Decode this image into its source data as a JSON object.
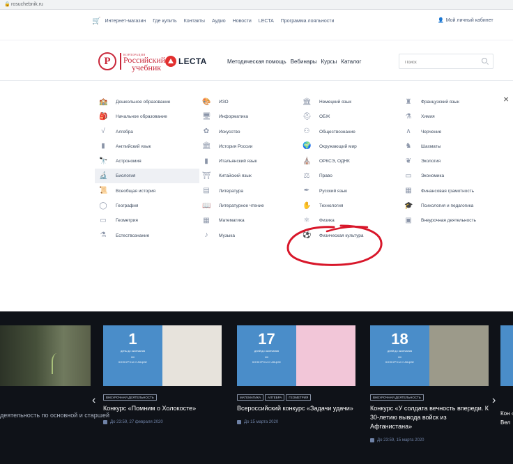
{
  "browser": {
    "url": "rosuchebnik.ru"
  },
  "topbar": {
    "cart_icon": "cart-icon",
    "links": [
      "Интернет-магазин",
      "Где купить",
      "Контакты",
      "Аудио",
      "Новости",
      "LECTA",
      "Программа лояльности"
    ],
    "account": "Мой личный кабинет"
  },
  "header": {
    "logo_mark": "Р",
    "logo_small": "КОРПОРАЦИЯ",
    "logo_line1": "Российский",
    "logo_line2": "учебник",
    "lecta": "LECTA",
    "nav": [
      "Методическая помощь",
      "Вебинары",
      "Курсы",
      "Каталог"
    ],
    "search_placeholder": "Поиск"
  },
  "subjects": {
    "close_label": "×",
    "col1": [
      {
        "label": "Дошкольное образование",
        "icon": "🏫"
      },
      {
        "label": "Начальное образование",
        "icon": "🎒"
      },
      {
        "label": "Алгебра",
        "icon": "√"
      },
      {
        "label": "Английский язык",
        "icon": "▮"
      },
      {
        "label": "Астрономия",
        "icon": "🔭"
      },
      {
        "label": "Биология",
        "icon": "🔬",
        "active": true
      },
      {
        "label": "Всеобщая история",
        "icon": "📜"
      },
      {
        "label": "География",
        "icon": "◯"
      },
      {
        "label": "Геометрия",
        "icon": "▭"
      },
      {
        "label": "Естествознание",
        "icon": "⚗"
      }
    ],
    "col2": [
      {
        "label": "ИЗО",
        "icon": "🎨"
      },
      {
        "label": "Информатика",
        "icon": "🖥"
      },
      {
        "label": "Искусство",
        "icon": "✿"
      },
      {
        "label": "История России",
        "icon": "🏛"
      },
      {
        "label": "Итальянский язык",
        "icon": "▮"
      },
      {
        "label": "Китайский язык",
        "icon": "⛩"
      },
      {
        "label": "Литература",
        "icon": "▤"
      },
      {
        "label": "Литературное чтение",
        "icon": "📖"
      },
      {
        "label": "Математика",
        "icon": "▦"
      },
      {
        "label": "Музыка",
        "icon": "♪"
      }
    ],
    "col3": [
      {
        "label": "Немецкий язык",
        "icon": "🏛"
      },
      {
        "label": "ОБЖ",
        "icon": "⛑"
      },
      {
        "label": "Обществознание",
        "icon": "⚇"
      },
      {
        "label": "Окружающий мир",
        "icon": "🌍"
      },
      {
        "label": "ОРКСЭ, ОДНК",
        "icon": "⛪"
      },
      {
        "label": "Право",
        "icon": "⚖"
      },
      {
        "label": "Русский язык",
        "icon": "✒"
      },
      {
        "label": "Технология",
        "icon": "✋"
      },
      {
        "label": "Физика",
        "icon": "⚛"
      },
      {
        "label": "Физическая культура",
        "icon": "⚽"
      }
    ],
    "col4": [
      {
        "label": "Французский язык",
        "icon": "♜"
      },
      {
        "label": "Химия",
        "icon": "⚗"
      },
      {
        "label": "Черчение",
        "icon": "∧"
      },
      {
        "label": "Шахматы",
        "icon": "♞"
      },
      {
        "label": "Экология",
        "icon": "❦"
      },
      {
        "label": "Экономика",
        "icon": "▭"
      },
      {
        "label": "Финансовая грамотность",
        "icon": "▦"
      },
      {
        "label": "Психология и педагогика",
        "icon": "🎓"
      },
      {
        "label": "Внеурочная деятельность",
        "icon": "▣"
      }
    ]
  },
  "promo": {
    "left_text": "деятельность по основной и старшей",
    "cards": [
      {
        "num": "1",
        "days": "день до окончания",
        "category": "КОНКУРСЫ И АКЦИИ",
        "tags": [
          "ВНЕУРОЧНАЯ ДЕЯТЕЛЬНОСТЬ"
        ],
        "title": "Конкурс «Помним о Холокосте»",
        "date": "До 23:59, 27 февраля 2020",
        "photo": "#e7e3dc"
      },
      {
        "num": "17",
        "days": "дней до окончания",
        "category": "КОНКУРСЫ И АКЦИИ",
        "tags": [
          "МАТЕМАТИКА",
          "АЛГЕБРА",
          "ГЕОМЕТРИЯ"
        ],
        "title": "Всероссийский конкурс «Задачи удачи»",
        "date": "До 15 марта 2020",
        "photo": "#f2c6d8"
      },
      {
        "num": "18",
        "days": "дней до окончания",
        "category": "КОНКУРСЫ И АКЦИИ",
        "tags": [
          "ВНЕУРОЧНАЯ ДЕЯТЕЛЬНОСТЬ"
        ],
        "title": "Конкурс «У солдата вечность впереди. К 30-летию вывода войск из Афганистана»",
        "date": "До 23:59, 15 марта 2020",
        "photo": "#9c9a8a"
      }
    ],
    "right_text": "Кон «Ур Вел",
    "prev_arrow": "‹",
    "next_arrow": "›"
  },
  "colors": {
    "accent_red": "#c9273a",
    "card_blue": "#4a8dc9",
    "annotation": "#d8172a"
  }
}
